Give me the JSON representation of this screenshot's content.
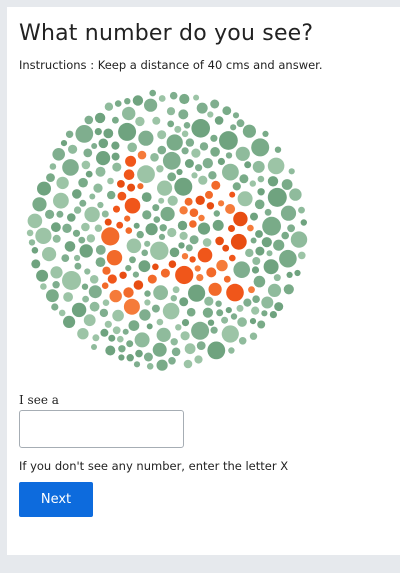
{
  "page": {
    "title": "What number do you see?",
    "instructions": "Instructions : Keep a distance of 40 cms and answer."
  },
  "plate": {
    "dot_colors": {
      "background": "#7fae8e",
      "figure": "#f0561a"
    }
  },
  "form": {
    "answer_label": "I see a",
    "answer_value": "",
    "hint": "If you don't see any number, enter the letter X",
    "next_label": "Next"
  }
}
